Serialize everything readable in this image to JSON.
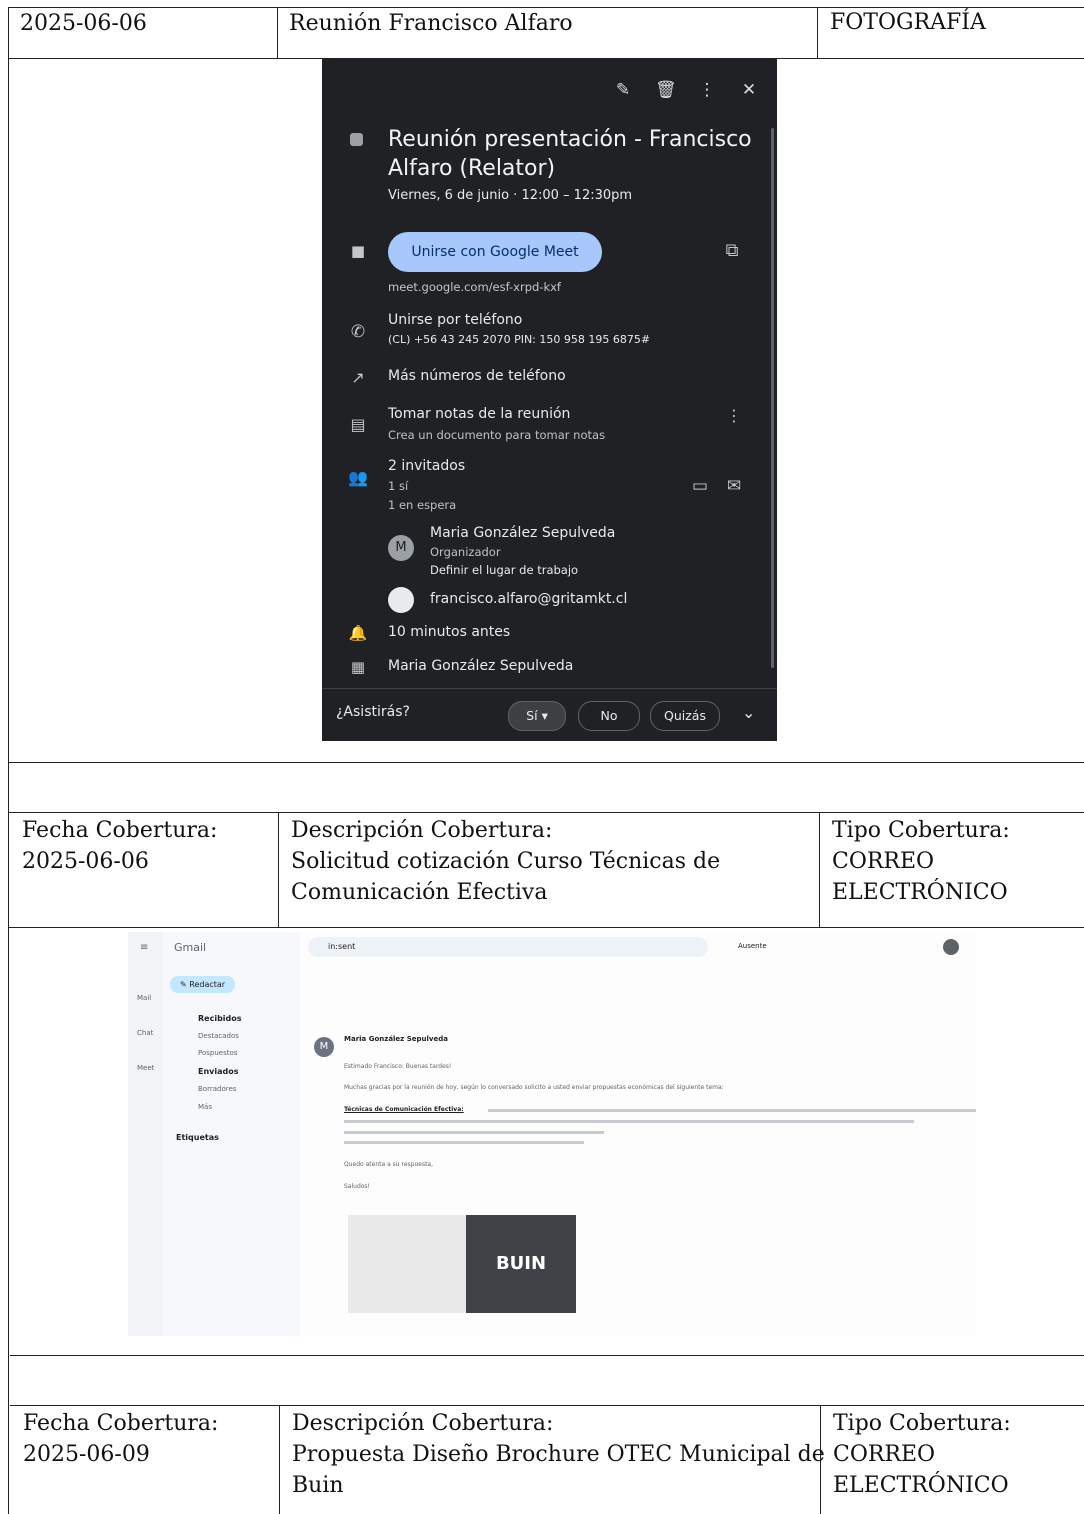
{
  "top_row": {
    "date": "2025-06-06",
    "title": "Reunión Francisco Alfaro",
    "type": "FOTOGRAFÍA"
  },
  "calendar_event": {
    "title_line1": "Reunión presentación - Francisco",
    "title_line2": "Alfaro (Relator)",
    "when": "Viernes, 6 de junio  ·  12:00 – 12:30pm",
    "meet_button": "Unirse con Google Meet",
    "meet_link": "meet.google.com/esf-xrpd-kxf",
    "phone_label": "Unirse por teléfono",
    "phone_detail": "(CL) +56 43 245 2070 PIN: 150 958 195 6875#",
    "more_numbers": "Más números de teléfono",
    "notes_label": "Tomar notas de la reunión",
    "notes_detail": "Crea un documento para tomar notas",
    "guests_count": "2 invitados",
    "guests_yes": "1 sí",
    "guests_waiting": "1 en espera",
    "organizer_name": "Maria González Sepulveda",
    "organizer_role": "Organizador",
    "organizer_workplace": "Definir el lugar de trabajo",
    "organizer_initial": "M",
    "guest_email": "francisco.alfaro@gritamkt.cl",
    "reminder": "10 minutos antes",
    "calendar_owner": "Maria González Sepulveda",
    "rsvp_question": "¿Asistirás?",
    "rsvp_yes": "Sí",
    "rsvp_no": "No",
    "rsvp_maybe": "Quizás"
  },
  "row2": {
    "date_label": "Fecha Cobertura:",
    "date": "2025-06-06",
    "desc_label": "Descripción Cobertura:",
    "desc_line1": "Solicitud cotización Curso Técnicas de",
    "desc_line2": "Comunicación Efectiva",
    "type_label": "Tipo Cobertura:",
    "type_line1": "CORREO",
    "type_line2": "ELECTRÓNICO"
  },
  "gmail": {
    "logo": "Gmail",
    "search_value": "in:sent",
    "status": "Ausente",
    "compose": "Redactar",
    "nav": [
      "Recibidos",
      "Destacados",
      "Pospuestos",
      "Enviados",
      "Borradores",
      "Más"
    ],
    "labels": "Etiquetas",
    "rail": [
      "Mail",
      "Chat",
      "Meet"
    ],
    "sender": "Maria González Sepulveda",
    "sender_initial": "M",
    "greeting": "Estimado Francisco: Buenas tardes!",
    "intro": "Muchas gracias por la reunión de hoy, según lo conversado solicito a usted enviar propuestas económicas del siguiente tema:",
    "course_title": "Técnicas de Comunicación Efectiva:",
    "closing": "Quedo atenta a su respuesta,",
    "salute": "Saludos!",
    "brand": "BUIN"
  },
  "row3": {
    "date_label": "Fecha Cobertura:",
    "date": "2025-06-09",
    "desc_label": "Descripción Cobertura:",
    "desc_line1": "Propuesta Diseño Brochure OTEC Municipal de",
    "desc_line2": "Buin",
    "type_label": "Tipo Cobertura:",
    "type_line1": "CORREO",
    "type_line2": "ELECTRÓNICO"
  }
}
